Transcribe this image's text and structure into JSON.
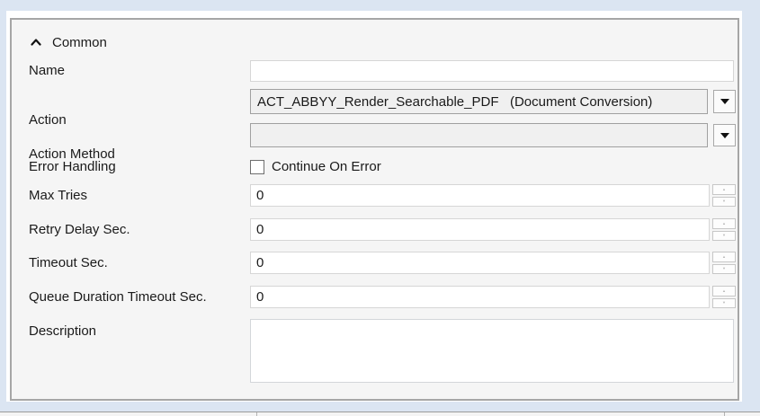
{
  "colors": {
    "window_background": "#dbe5f2",
    "panel_background": "#f5f5f5",
    "panel_border": "#a6a6a6",
    "combo_background": "#f0f0f0",
    "text": "#1a1a1a"
  },
  "section": {
    "title": "Common",
    "collapse_icon": "chevron-up",
    "expanded": true
  },
  "fields": {
    "name": {
      "label": "Name",
      "value": ""
    },
    "action": {
      "label": "Action",
      "value": "ACT_ABBYY_Render_Searchable_PDF   (Document Conversion)"
    },
    "action_method": {
      "label": "Action Method",
      "value": ""
    },
    "error_handling": {
      "label": "Error Handling",
      "checkbox_label": "Continue On Error",
      "checked": false
    },
    "max_tries": {
      "label": "Max Tries",
      "value": "0"
    },
    "retry_delay": {
      "label": "Retry Delay Sec.",
      "value": "0"
    },
    "timeout": {
      "label": "Timeout Sec.",
      "value": "0"
    },
    "queue_duration_timeout": {
      "label": "Queue Duration Timeout Sec.",
      "value": "0"
    },
    "description": {
      "label": "Description",
      "value": ""
    }
  }
}
